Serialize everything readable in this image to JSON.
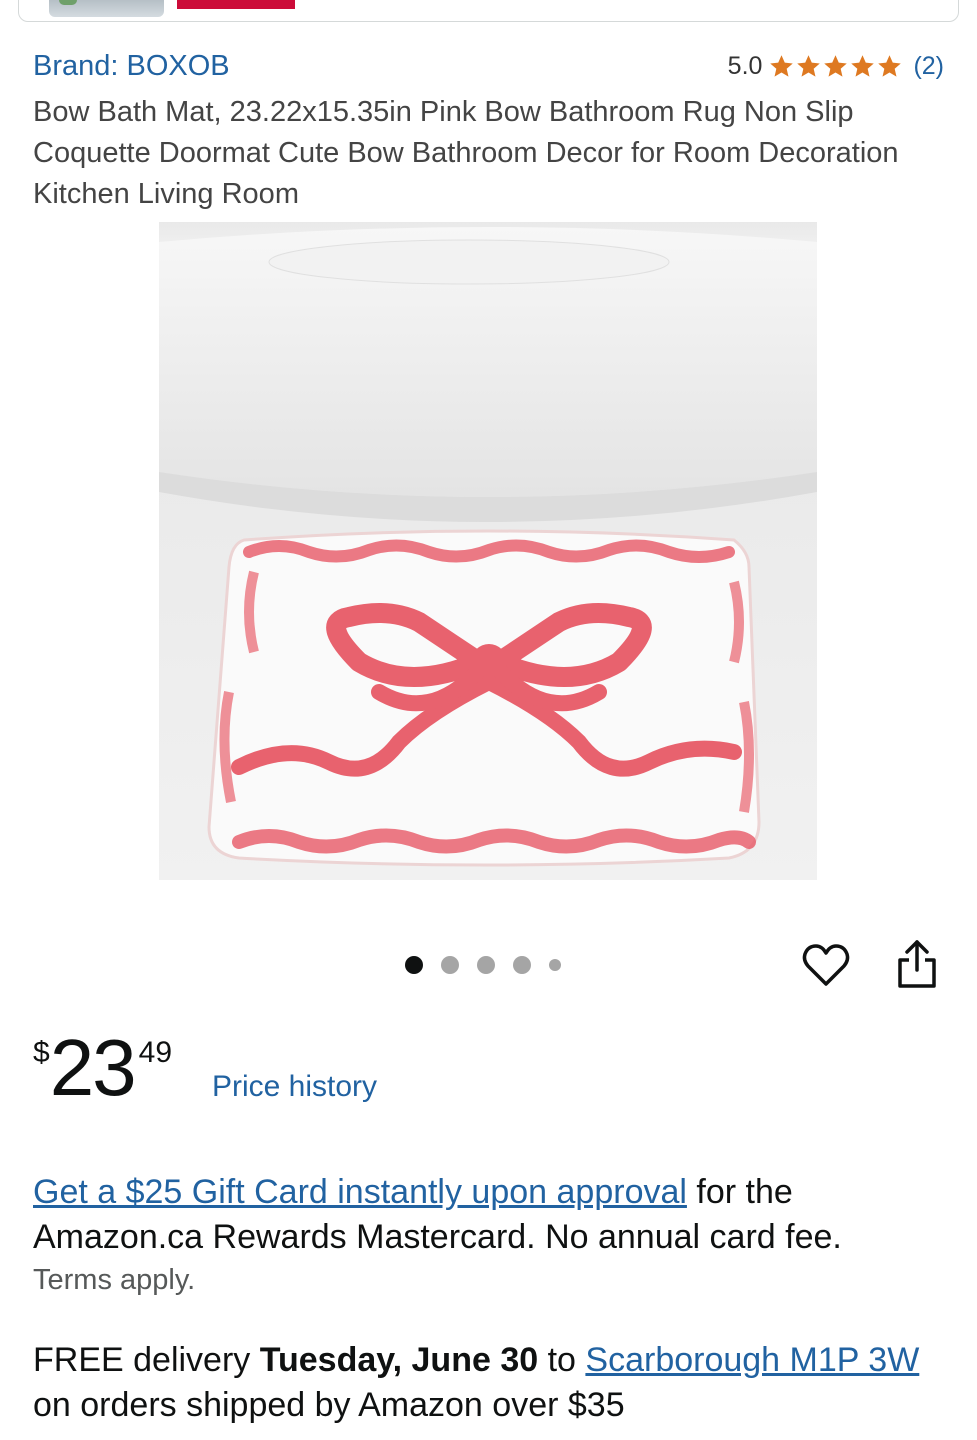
{
  "brand": {
    "label": "Brand: BOXOB"
  },
  "rating": {
    "score": "5.0",
    "stars": 5,
    "count": "(2)",
    "star_color": "#de7921"
  },
  "product": {
    "title": "Bow Bath Mat, 23.22x15.35in Pink Bow Bathroom Rug Non Slip Coquette Doormat Cute Bow Bathroom Decor for Room Decoration Kitchen Living Room"
  },
  "carousel": {
    "total": 5,
    "active_index": 0
  },
  "actions": {
    "wishlist_icon": "heart-icon",
    "share_icon": "share-icon"
  },
  "price": {
    "currency": "$",
    "whole": "23",
    "fraction": "49",
    "history_label": "Price history"
  },
  "promo": {
    "link_text": "Get a $25 Gift Card instantly upon approval",
    "rest_text": " for the Amazon.ca Rewards Mastercard. No annual card fee.",
    "terms": "Terms apply."
  },
  "delivery": {
    "prefix": "FREE delivery ",
    "date": "Tuesday, June 30",
    "to": " to ",
    "location": "Scarborough M1P 3W",
    "suffix": " on orders shipped by Amazon over $35"
  },
  "colors": {
    "link": "#2162a1",
    "text": "#0f1111",
    "accent_pink": "#e8626e"
  }
}
